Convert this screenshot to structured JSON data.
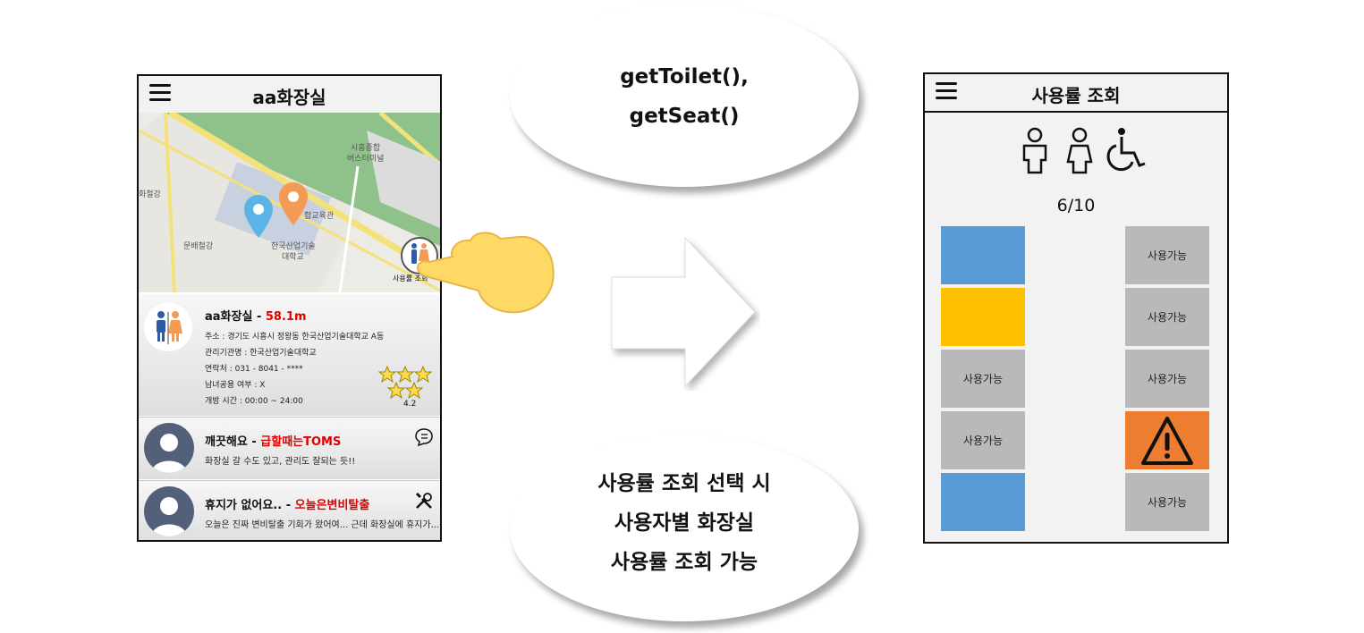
{
  "left_phone": {
    "title": "aa화장실",
    "map": {
      "labels": [
        "시흥종합",
        "버스터미널",
        "합교육관",
        "한국산업기술",
        "대학교",
        "문배철강",
        "화철강"
      ],
      "pins": [
        {
          "color": "#5bb4e5"
        },
        {
          "color": "#f39a54"
        }
      ],
      "button_label": "사용률 조회"
    },
    "info": {
      "name": "aa화장실",
      "separator": " - ",
      "distance": "58.1m",
      "lines": [
        "주소 : 경기도 시흥시 정왕동 한국산업기술대학교 A동",
        "관리기관명 : 한국산업기술대학교",
        "연락처 : 031 - 8041 - ****",
        "남녀공용 여부 : X",
        "개방 시간 : 00:00 ~ 24:00"
      ],
      "rating": "4.2",
      "star_color": "#ffd84d"
    },
    "reviews": [
      {
        "text": "깨끗해요",
        "separator": " - ",
        "user": "급할때는TOMS",
        "body": "화장실 갈 수도 있고, 관리도 잘되는 듯!!",
        "icon": "comment-icon"
      },
      {
        "text": "휴지가 없어요..",
        "separator": " - ",
        "user": "오늘은변비탈출",
        "body": "오늘은 진짜 변비탈출 기회가 왔어여... 근데 화장실에 휴지가...",
        "icon": "tools-icon"
      }
    ]
  },
  "bubbles": {
    "top": [
      "getToilet(),",
      "getSeat()"
    ],
    "bottom": [
      "사용률 조회 선택 시",
      "사용자별 화장실",
      "사용률 조회 가능"
    ]
  },
  "right_phone": {
    "title": "사용률 조회",
    "icons": [
      "male-icon",
      "female-icon",
      "wheelchair-icon"
    ],
    "usage": "6/10",
    "seats_left": [
      {
        "status": "in-use",
        "color": "#5b9bd5",
        "label": ""
      },
      {
        "status": "in-use",
        "color": "#ffc000",
        "label": ""
      },
      {
        "status": "free",
        "color": "#b9b9b9",
        "label": "사용가능"
      },
      {
        "status": "free",
        "color": "#b9b9b9",
        "label": "사용가능"
      },
      {
        "status": "in-use",
        "color": "#5b9bd5",
        "label": ""
      }
    ],
    "seats_right": [
      {
        "status": "free",
        "color": "#b9b9b9",
        "label": "사용가능"
      },
      {
        "status": "free",
        "color": "#b9b9b9",
        "label": "사용가능"
      },
      {
        "status": "free",
        "color": "#b9b9b9",
        "label": "사용가능"
      },
      {
        "status": "warning",
        "color": "#ed7d31",
        "label": ""
      },
      {
        "status": "free",
        "color": "#b9b9b9",
        "label": "사용가능"
      }
    ]
  }
}
